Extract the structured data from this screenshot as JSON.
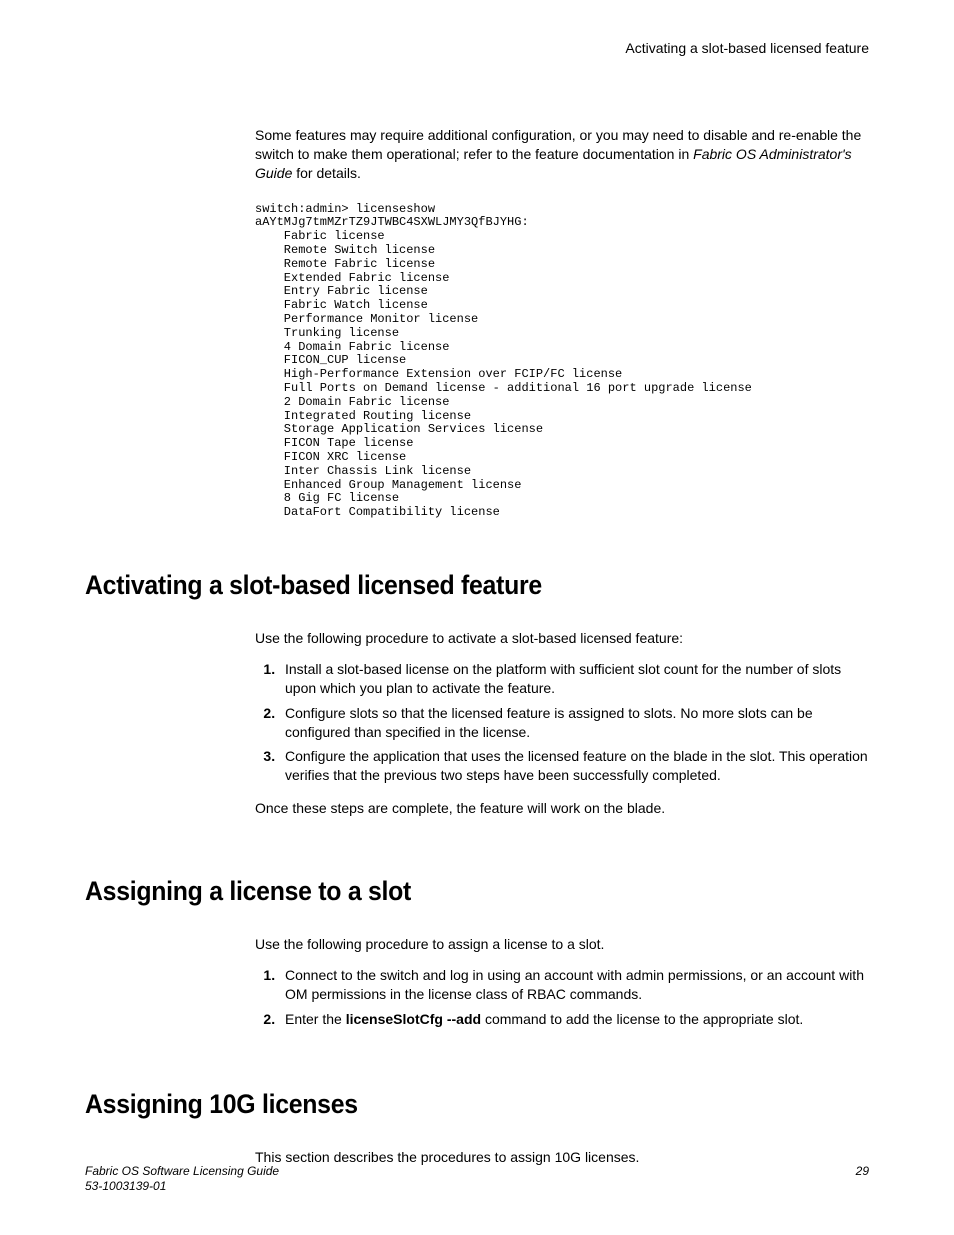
{
  "header": {
    "right": "Activating a slot-based licensed feature"
  },
  "intro": {
    "text_before": "Some features may require additional configuration, or you may need to disable and re-enable the switch to make them operational; refer to the feature documentation in ",
    "italic": "Fabric OS Administrator's Guide",
    "text_after": " for details."
  },
  "code": "switch:admin> licenseshow\naAYtMJg7tmMZrTZ9JTWBC4SXWLJMY3QfBJYHG:\n    Fabric license\n    Remote Switch license\n    Remote Fabric license\n    Extended Fabric license\n    Entry Fabric license\n    Fabric Watch license\n    Performance Monitor license\n    Trunking license\n    4 Domain Fabric license\n    FICON_CUP license\n    High-Performance Extension over FCIP/FC license\n    Full Ports on Demand license - additional 16 port upgrade license\n    2 Domain Fabric license\n    Integrated Routing license\n    Storage Application Services license\n    FICON Tape license\n    FICON XRC license\n    Inter Chassis Link license\n    Enhanced Group Management license\n    8 Gig FC license\n    DataFort Compatibility license",
  "section1": {
    "title": "Activating a slot-based licensed feature",
    "intro": "Use the following procedure to activate a slot-based licensed feature:",
    "steps": [
      "Install a slot-based license on the platform with sufficient slot count for the number of slots upon which you plan to activate the feature.",
      "Configure slots so that the licensed feature is assigned to slots. No more slots can be configured than specified in the license.",
      "Configure the application that uses the licensed feature on the blade in the slot. This operation verifies that the previous two steps have been successfully completed."
    ],
    "outro": "Once these steps are complete, the feature will work on the blade."
  },
  "section2": {
    "title": "Assigning a license to a slot",
    "intro": "Use the following procedure to assign a license to a slot.",
    "step1": "Connect to the switch and log in using an account with admin permissions, or an account with OM permissions in the license class of RBAC commands.",
    "step2_pre": "Enter the ",
    "step2_bold": "licenseSlotCfg --add",
    "step2_post": " command to add the license to the appropriate slot."
  },
  "section3": {
    "title": "Assigning 10G licenses",
    "intro": "This section describes the procedures to assign 10G licenses."
  },
  "footer": {
    "title": "Fabric OS Software Licensing Guide",
    "docnum": "53-1003139-01",
    "page": "29"
  }
}
